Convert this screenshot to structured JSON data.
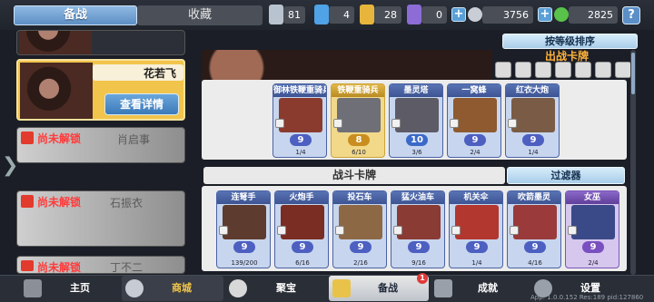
{
  "top": {
    "tab_active": "备战",
    "tab_inactive": "收藏",
    "resources": [
      {
        "icon": "silver-chest-icon",
        "value": "81",
        "color": "#b9c3cf"
      },
      {
        "icon": "blue-chest-icon",
        "value": "4",
        "color": "#4fa3e6"
      },
      {
        "icon": "gold-chest-icon",
        "value": "28",
        "color": "#e7b53c"
      },
      {
        "icon": "purple-chest-icon",
        "value": "0",
        "color": "#8d6cd6"
      }
    ],
    "silver_coin": "3756",
    "green_gem": "2825",
    "help": "?"
  },
  "heroes": {
    "selected_name": "花若飞",
    "detail_button": "查看详情",
    "locked_label": "尚未解锁",
    "locked_names": [
      "肖启事",
      "石振衣",
      "丁不二"
    ]
  },
  "sort_button": "按等级排序",
  "deck_title": "出战卡牌",
  "deck_cards": [
    {
      "name": "御林铁鞭重骑兵",
      "level": "9",
      "progress": "1/4",
      "art": "#8b3b2e"
    },
    {
      "name": "铁鞭重骑兵",
      "level": "8",
      "progress": "6/10",
      "art": "#6f6f78"
    },
    {
      "name": "墨灵塔",
      "level": "10",
      "progress": "3/6",
      "art": "#5d5b66"
    },
    {
      "name": "一窝蜂",
      "level": "9",
      "progress": "2/4",
      "art": "#8f5a2f"
    },
    {
      "name": "红衣大炮",
      "level": "9",
      "progress": "1/4",
      "art": "#7a5b45"
    }
  ],
  "pool_section_title": "战斗卡牌",
  "filter_button": "过滤器",
  "pool_cards": [
    {
      "name": "连弩手",
      "level": "9",
      "progress": "139/200",
      "art": "#5e3b2f"
    },
    {
      "name": "火炮手",
      "level": "9",
      "progress": "6/16",
      "art": "#7a2d22"
    },
    {
      "name": "投石车",
      "level": "9",
      "progress": "2/16",
      "art": "#8d6845"
    },
    {
      "name": "猛火油车",
      "level": "9",
      "progress": "9/16",
      "art": "#8a3b33"
    },
    {
      "name": "机关伞",
      "level": "9",
      "progress": "1/4",
      "art": "#b2372f"
    },
    {
      "name": "吹箭墨灵",
      "level": "9",
      "progress": "4/16",
      "art": "#9a3a3a"
    },
    {
      "name": "女巫",
      "level": "9",
      "progress": "2/4",
      "art": "#3a4a88"
    }
  ],
  "nav": {
    "home": "主页",
    "shop": "商城",
    "treasure": "聚宝",
    "prepare": "备战",
    "achievement": "成就",
    "settings": "设置",
    "badge": "1",
    "version": "App: 1.0.0.152 Res:189 pid:127860"
  }
}
